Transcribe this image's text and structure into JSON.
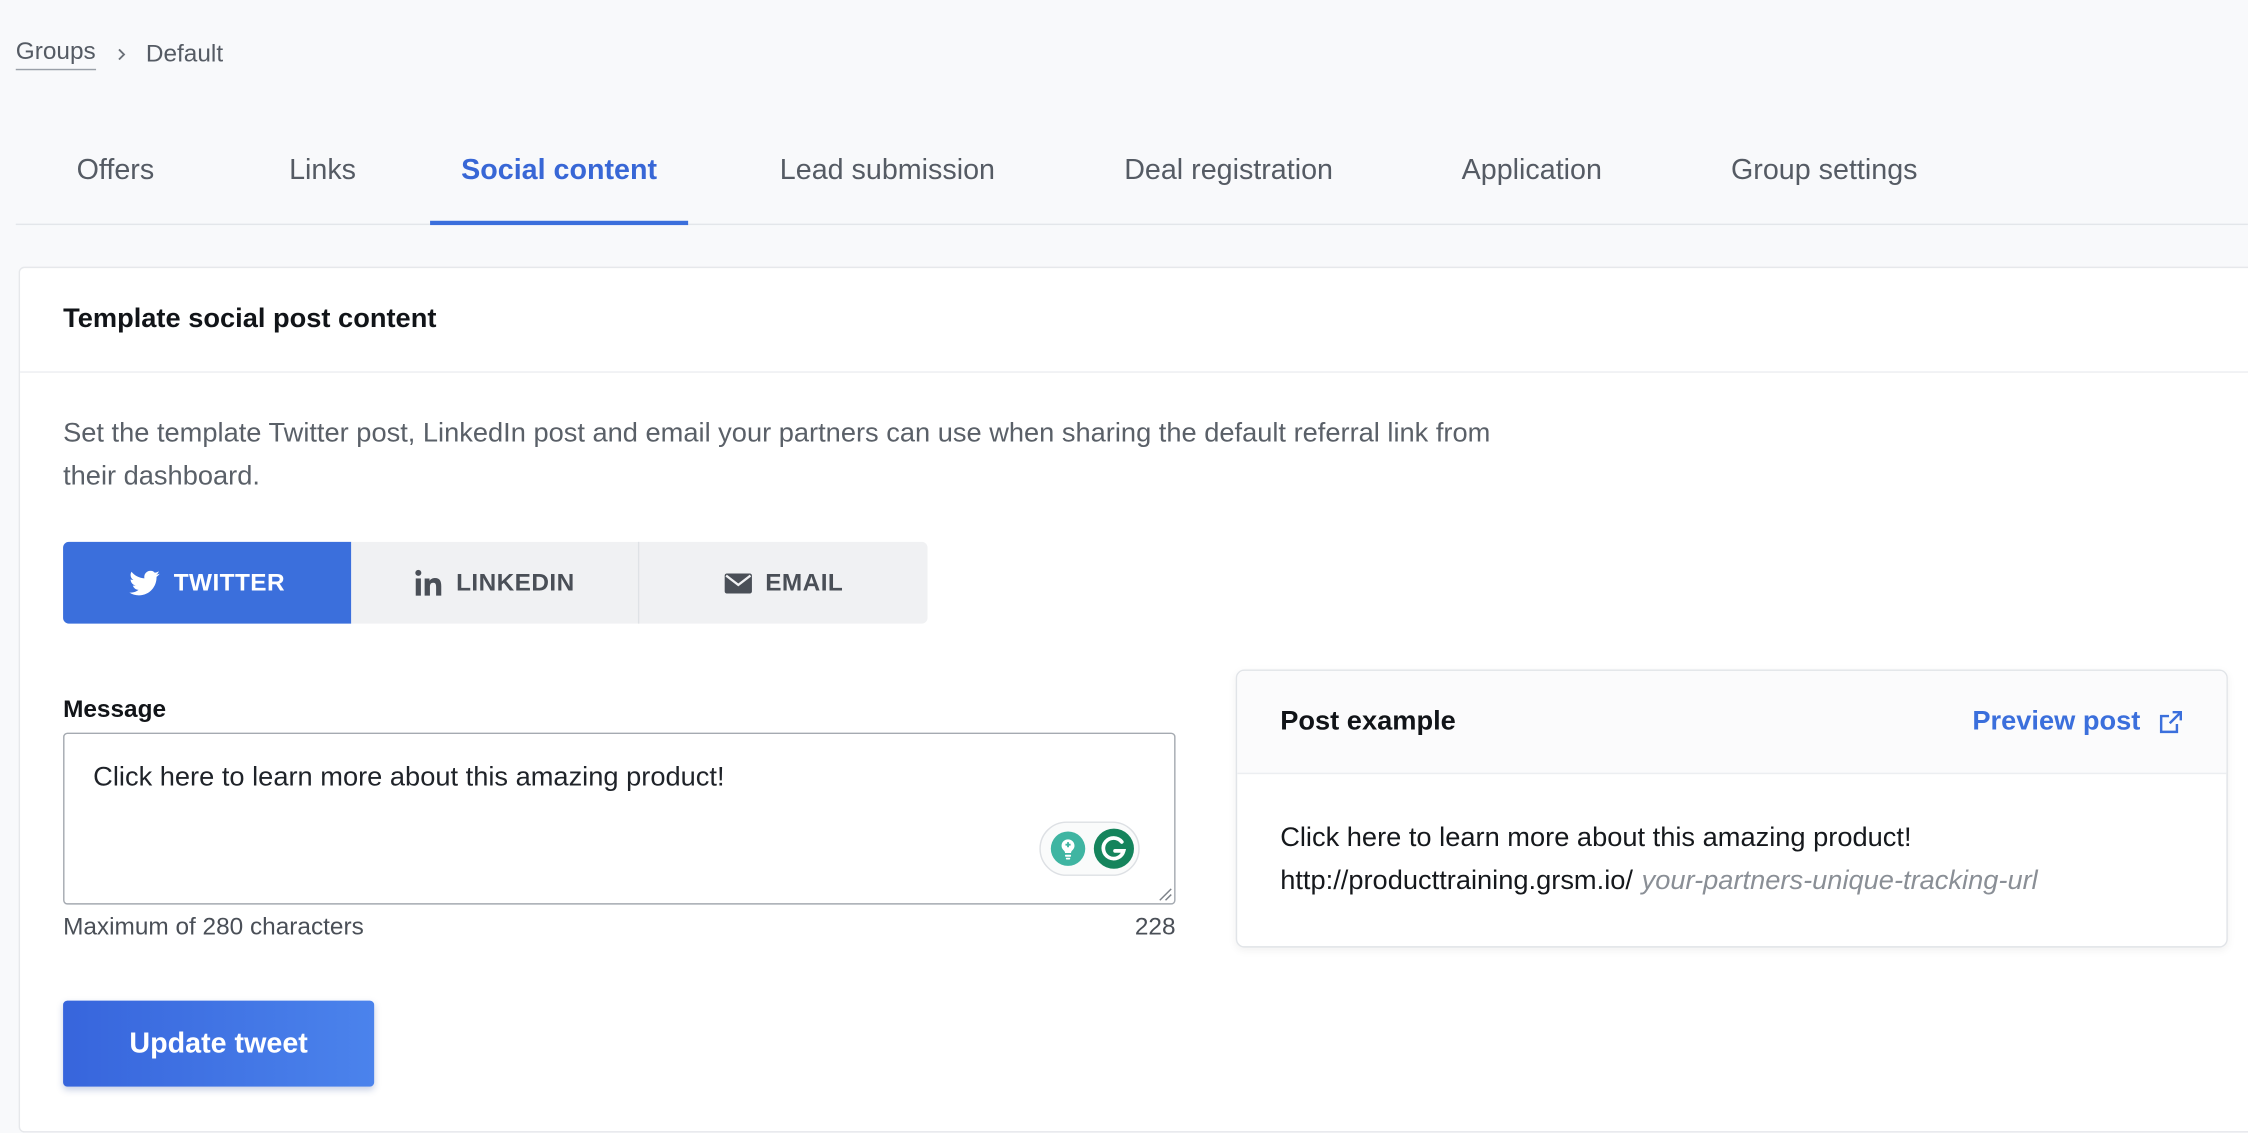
{
  "breadcrumb": {
    "parent": "Groups",
    "current": "Default"
  },
  "tabs": [
    {
      "label": "Offers",
      "active": false
    },
    {
      "label": "Links",
      "active": false
    },
    {
      "label": "Social content",
      "active": true
    },
    {
      "label": "Lead submission",
      "active": false
    },
    {
      "label": "Deal registration",
      "active": false
    },
    {
      "label": "Application",
      "active": false
    },
    {
      "label": "Group settings",
      "active": false
    }
  ],
  "card": {
    "title": "Template social post content",
    "description": "Set the template Twitter post, LinkedIn post and email your partners can use when sharing the default referral link from their dashboard."
  },
  "channels": [
    {
      "label": "TWITTER",
      "icon": "twitter-icon",
      "active": true
    },
    {
      "label": "LINKEDIN",
      "icon": "linkedin-icon",
      "active": false
    },
    {
      "label": "EMAIL",
      "icon": "envelope-icon",
      "active": false
    }
  ],
  "message": {
    "label": "Message",
    "value": "Click here to learn more about this amazing product!",
    "hint": "Maximum of 280 characters",
    "remaining": "228"
  },
  "update_button": "Update tweet",
  "example": {
    "title": "Post example",
    "preview_label": "Preview post",
    "body_text": "Click here to learn more about this amazing product!",
    "url_base": "http://producttraining.grsm.io/",
    "url_placeholder": "your-partners-unique-tracking-url"
  },
  "colors": {
    "accent": "#3b6fdc",
    "page_bg": "#f8f9fb",
    "segment_bg": "#f0f1f3"
  }
}
